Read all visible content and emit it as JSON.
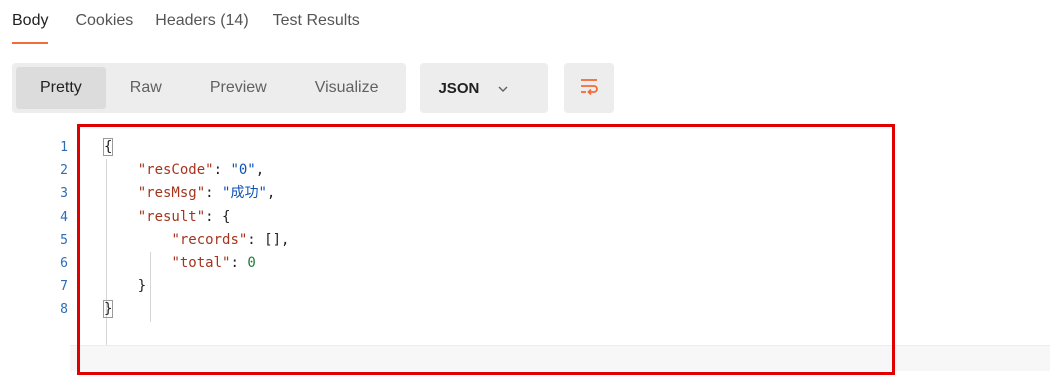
{
  "response_tabs": {
    "body": "Body",
    "cookies": "Cookies",
    "headers": "Headers (14)",
    "test_results": "Test Results"
  },
  "view_modes": {
    "pretty": "Pretty",
    "raw": "Raw",
    "preview": "Preview",
    "visualize": "Visualize"
  },
  "format_select": {
    "value": "JSON"
  },
  "icons": {
    "format_dropdown": "chevron-down-icon",
    "wrap_lines": "wrap-lines-icon"
  },
  "colors": {
    "active_tab_underline": "#f26b3a",
    "highlight_box": "#e00000",
    "json_key": "#a4351d",
    "json_string": "#0f52b8",
    "json_number": "#1c7a3a",
    "line_numbers": "#2a6db6"
  },
  "editor": {
    "line_numbers": [
      "1",
      "2",
      "3",
      "4",
      "5",
      "6",
      "7",
      "8"
    ],
    "lines": {
      "open_brace": "{",
      "res_code_key": "\"resCode\"",
      "res_code_value": "\"0\"",
      "res_msg_key": "\"resMsg\"",
      "res_msg_value": "\"成功\"",
      "result_key": "\"result\"",
      "records_key": "\"records\"",
      "records_value": "[]",
      "total_key": "\"total\"",
      "total_value": "0",
      "inner_close_brace": "}",
      "close_brace": "}"
    }
  }
}
